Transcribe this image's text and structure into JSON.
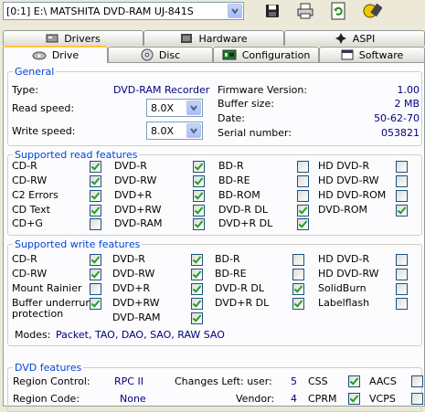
{
  "toolbar": {
    "device": "[0:1]  E:\\ MATSHITA DVD-RAM UJ-841S",
    "icons": [
      "save-icon",
      "print-icon",
      "refresh-icon",
      "about-icon"
    ]
  },
  "tabs_top": [
    "Drivers",
    "Hardware",
    "ASPI"
  ],
  "tabs_bottom": [
    "Drive",
    "Disc",
    "Configuration",
    "Software"
  ],
  "general": {
    "legend": "General",
    "type_label": "Type:",
    "type_value": "DVD-RAM Recorder",
    "read_label": "Read speed:",
    "read_value": "8.0X",
    "write_label": "Write speed:",
    "write_value": "8.0X",
    "fw_label": "Firmware Version:",
    "fw_value": "1.00",
    "buf_label": "Buffer size:",
    "buf_value": "2 MB",
    "date_label": "Date:",
    "date_value": "50-62-70",
    "serial_label": "Serial number:",
    "serial_value": "053821"
  },
  "read_features": {
    "legend": "Supported read features",
    "cols": [
      [
        [
          "CD-R",
          true
        ],
        [
          "CD-RW",
          true
        ],
        [
          "C2 Errors",
          true
        ],
        [
          "CD Text",
          true
        ],
        [
          "CD+G",
          false
        ]
      ],
      [
        [
          "DVD-R",
          true
        ],
        [
          "DVD-RW",
          true
        ],
        [
          "DVD+R",
          true
        ],
        [
          "DVD+RW",
          true
        ],
        [
          "DVD-RAM",
          true
        ]
      ],
      [
        [
          "BD-R",
          false
        ],
        [
          "BD-RE",
          false
        ],
        [
          "BD-ROM",
          false
        ],
        [
          "DVD-R DL",
          true
        ],
        [
          "DVD+R DL",
          true
        ]
      ],
      [
        [
          "HD DVD-R",
          false
        ],
        [
          "HD DVD-RW",
          false
        ],
        [
          "HD DVD-ROM",
          false
        ],
        [
          "DVD-ROM",
          true
        ]
      ]
    ]
  },
  "write_features": {
    "legend": "Supported write features",
    "cols": [
      [
        [
          "CD-R",
          true
        ],
        [
          "CD-RW",
          true
        ],
        [
          "Mount Rainier",
          false
        ],
        [
          "Buffer underrun\nprotection",
          true
        ]
      ],
      [
        [
          "DVD-R",
          true
        ],
        [
          "DVD-RW",
          true
        ],
        [
          "DVD+R",
          true
        ],
        [
          "DVD+RW",
          true
        ],
        [
          "DVD-RAM",
          true
        ]
      ],
      [
        [
          "BD-R",
          false
        ],
        [
          "BD-RE",
          false
        ],
        [
          "DVD-R DL",
          true
        ],
        [
          "DVD+R DL",
          true
        ]
      ],
      [
        [
          "HD DVD-R",
          false
        ],
        [
          "HD DVD-RW",
          false
        ],
        [
          "SolidBurn",
          false
        ],
        [
          "Labelflash",
          false
        ]
      ]
    ],
    "modes_label": "Modes:",
    "modes_value": "Packet, TAO, DAO, SAO, RAW SAO"
  },
  "dvd_features": {
    "legend": "DVD features",
    "region_control_label": "Region Control:",
    "region_control_value": "RPC II",
    "changes_left_label": "Changes Left: user:",
    "changes_left_value": "5",
    "region_code_label": "Region Code:",
    "region_code_value": "None",
    "vendor_label": "Vendor:",
    "vendor_value": "4",
    "flags": [
      [
        "CSS",
        true
      ],
      [
        "AACS",
        false
      ],
      [
        "CPRM",
        true
      ],
      [
        "VCPS",
        false
      ]
    ]
  }
}
